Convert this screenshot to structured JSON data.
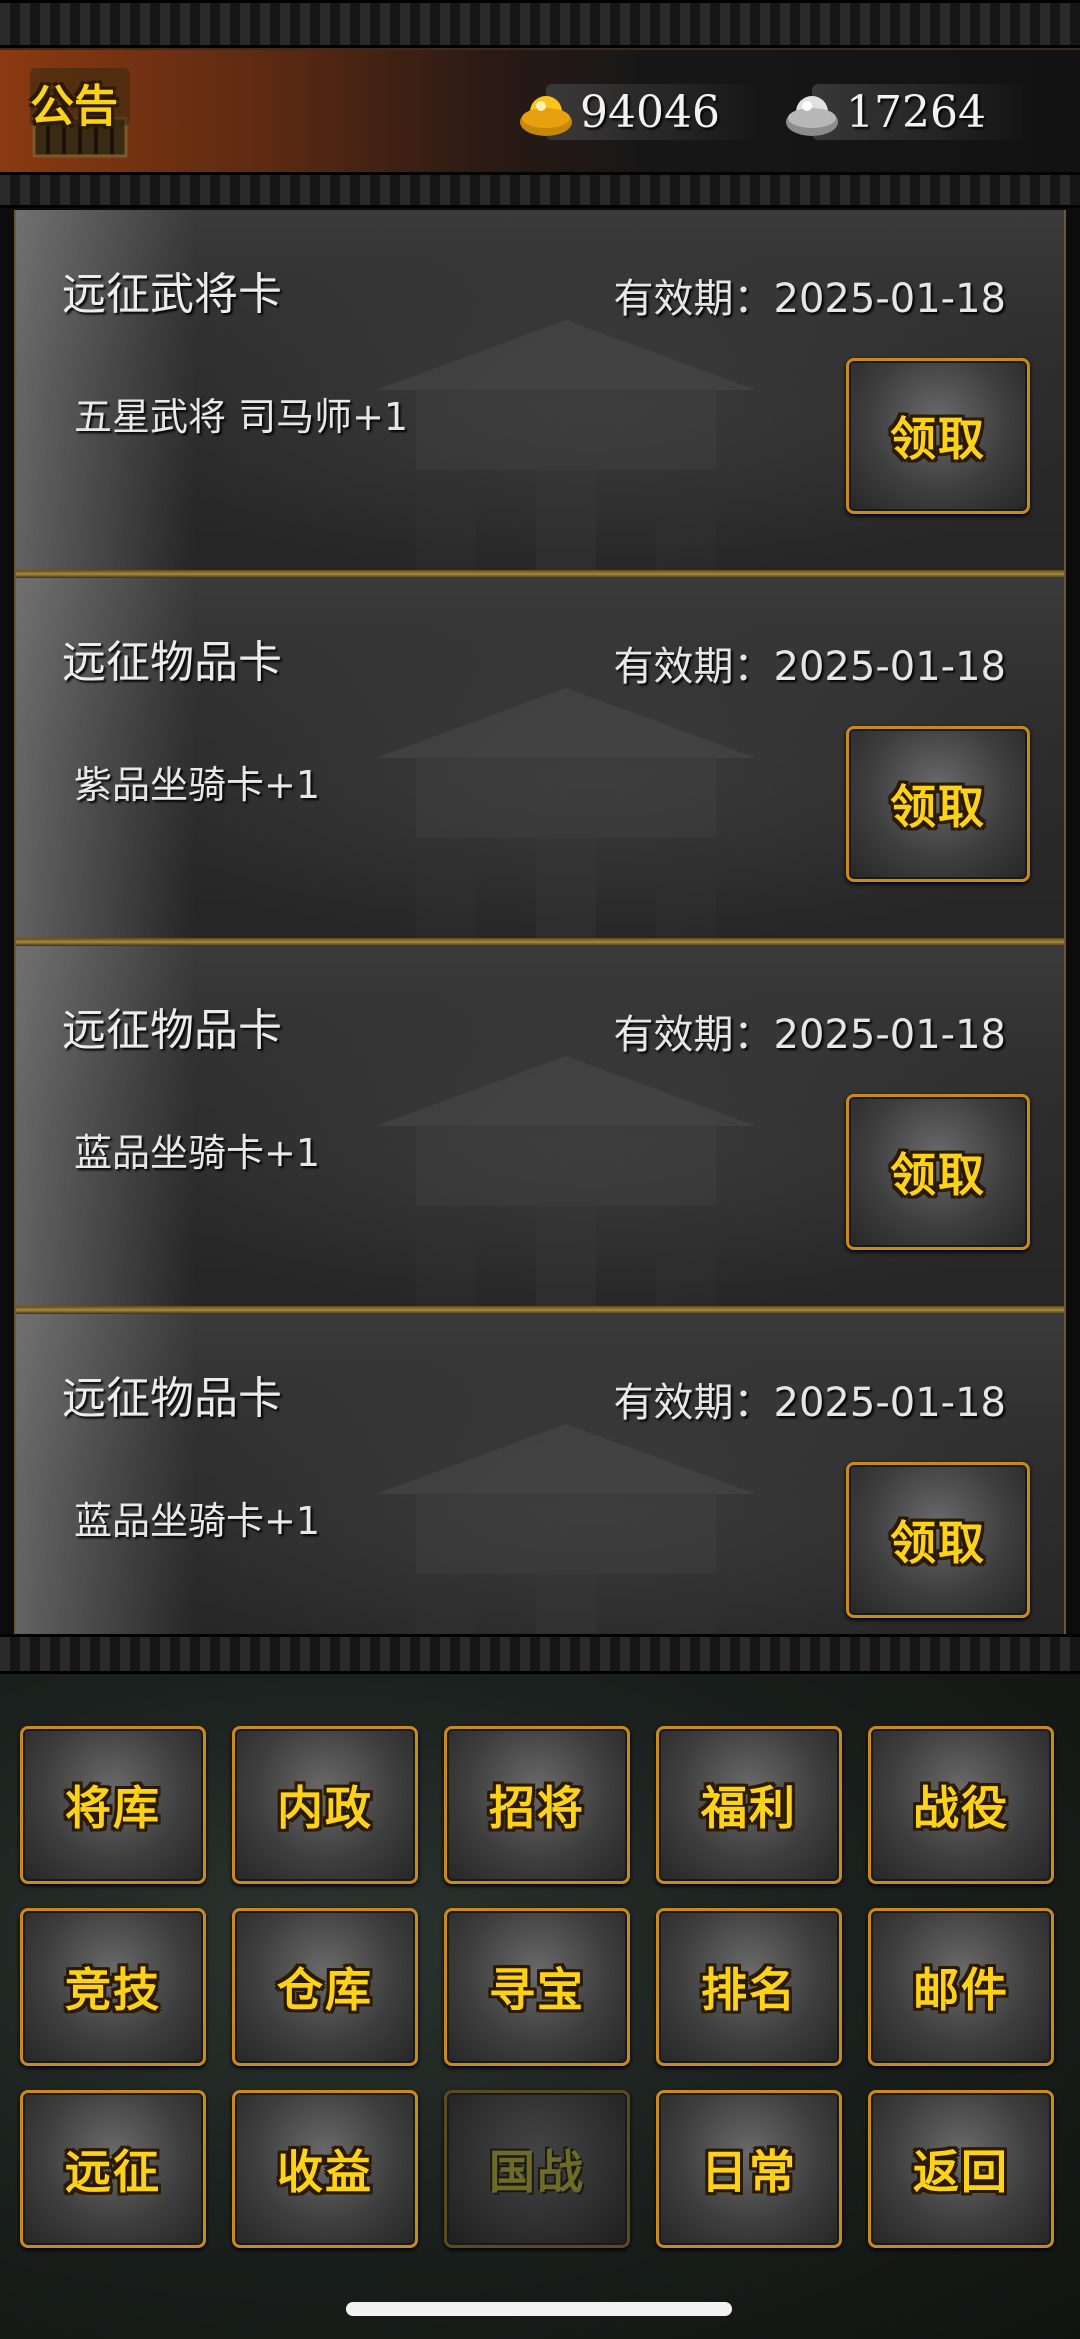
{
  "header": {
    "notice_label": "公告",
    "gold": {
      "icon": "gold-ingot-icon",
      "amount": "94046"
    },
    "silver": {
      "icon": "silver-ingot-icon",
      "amount": "17264"
    }
  },
  "cards": [
    {
      "title": "远征武将卡",
      "expiry": "有效期：2025-01-18",
      "reward": "五星武将 司马师+1",
      "claim_label": "领取"
    },
    {
      "title": "远征物品卡",
      "expiry": "有效期：2025-01-18",
      "reward": "紫品坐骑卡+1",
      "claim_label": "领取"
    },
    {
      "title": "远征物品卡",
      "expiry": "有效期：2025-01-18",
      "reward": "蓝品坐骑卡+1",
      "claim_label": "领取"
    },
    {
      "title": "远征物品卡",
      "expiry": "有效期：2025-01-18",
      "reward": "蓝品坐骑卡+1",
      "claim_label": "领取"
    }
  ],
  "menu": [
    {
      "label": "将库",
      "enabled": true
    },
    {
      "label": "内政",
      "enabled": true
    },
    {
      "label": "招将",
      "enabled": true
    },
    {
      "label": "福利",
      "enabled": true
    },
    {
      "label": "战役",
      "enabled": true
    },
    {
      "label": "竞技",
      "enabled": true
    },
    {
      "label": "仓库",
      "enabled": true
    },
    {
      "label": "寻宝",
      "enabled": true
    },
    {
      "label": "排名",
      "enabled": true
    },
    {
      "label": "邮件",
      "enabled": true
    },
    {
      "label": "远征",
      "enabled": true
    },
    {
      "label": "收益",
      "enabled": true
    },
    {
      "label": "国战",
      "enabled": false
    },
    {
      "label": "日常",
      "enabled": true
    },
    {
      "label": "返回",
      "enabled": true
    }
  ],
  "colors": {
    "button_text_gold": "#ffd21a",
    "button_border": "#c88a1a",
    "header_accent": "#8a3a10"
  }
}
